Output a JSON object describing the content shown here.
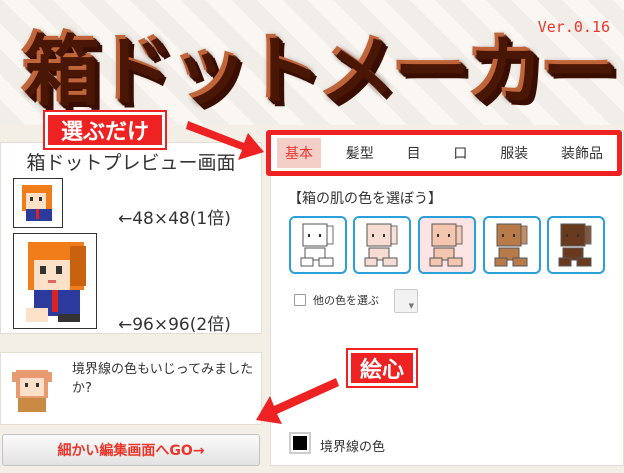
{
  "app": {
    "logo_text": "箱ドットメーカー",
    "version": "Ver.0.16"
  },
  "preview": {
    "title": "箱ドットプレビュー画面",
    "small_label": "←48×48(1倍)",
    "large_label": "←96×96(2倍)"
  },
  "comment": {
    "text": "境界線の色もいじってみましたか?"
  },
  "edit_button": {
    "label": "細かい編集画面へGO→"
  },
  "tabs": [
    "基本",
    "髪型",
    "目",
    "口",
    "服装",
    "装飾品"
  ],
  "active_tab": "基本",
  "skin": {
    "title": "【箱の肌の色を選ぼう】",
    "colors": [
      "#ffffff",
      "#f7dcd4",
      "#f4c6b0",
      "#b97a4a",
      "#6a3a1e"
    ],
    "selected_index": 2,
    "other_label": "他の色を選ぶ"
  },
  "border_color": {
    "label": "境界線の色",
    "value": "#000000"
  },
  "annotations": {
    "select_only": "選ぶだけ",
    "heart": "絵心"
  },
  "colors": {
    "accent_red": "#e8362b",
    "annotation_red": "#ee2222",
    "swatch_border": "#2a9fd8"
  }
}
